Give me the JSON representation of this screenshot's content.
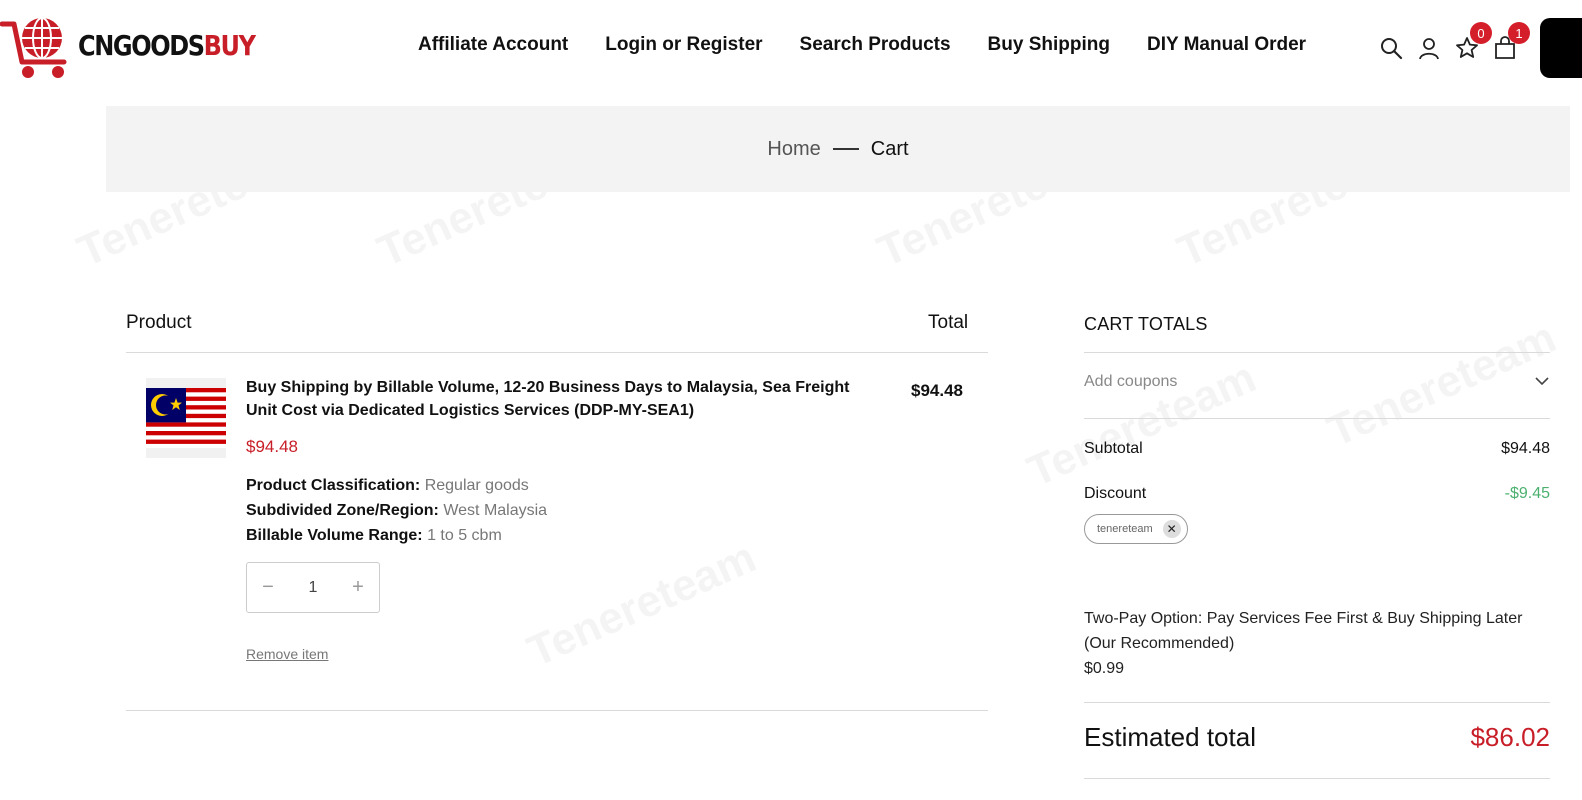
{
  "brand": {
    "prefix": "CNGOODS",
    "suffix": "BUY"
  },
  "nav": [
    "Affiliate Account",
    "Login or Register",
    "Search Products",
    "Buy Shipping",
    "DIY Manual Order"
  ],
  "header_icons": {
    "search": "search-icon",
    "account": "user-icon",
    "wishlist": {
      "icon": "star-icon",
      "count": "0"
    },
    "cart": {
      "icon": "bag-icon",
      "count": "1"
    }
  },
  "breadcrumb": {
    "home": "Home",
    "current": "Cart"
  },
  "table": {
    "product_header": "Product",
    "total_header": "Total"
  },
  "item": {
    "name": "Buy Shipping by Billable Volume, 12-20 Business Days to Malaysia, Sea Freight Unit Cost via Dedicated Logistics Services (DDP-MY-SEA1)",
    "price": "$94.48",
    "total": "$94.48",
    "attributes": [
      {
        "key": "Product Classification:",
        "value": "Regular goods"
      },
      {
        "key": "Subdivided Zone/Region:",
        "value": "West Malaysia"
      },
      {
        "key": "Billable Volume Range:",
        "value": "1 to 5 cbm"
      }
    ],
    "quantity": "1",
    "remove_label": "Remove item",
    "image": "malaysia-flag"
  },
  "totals": {
    "title": "CART TOTALS",
    "coupon_label": "Add coupons",
    "subtotal_label": "Subtotal",
    "subtotal_value": "$94.48",
    "discount_label": "Discount",
    "discount_value": "-$9.45",
    "coupon_code": "tenereteam",
    "twopay_text": "Two-Pay Option: Pay Services Fee First & Buy Shipping Later (Our Recommended)",
    "twopay_value": "$0.99",
    "estimated_label": "Estimated total",
    "estimated_value": "$86.02"
  },
  "watermark": "Tenereteam",
  "colors": {
    "brand_red": "#c81e27",
    "discount_green": "#4bb06e",
    "badge_red": "#d41f2b"
  }
}
